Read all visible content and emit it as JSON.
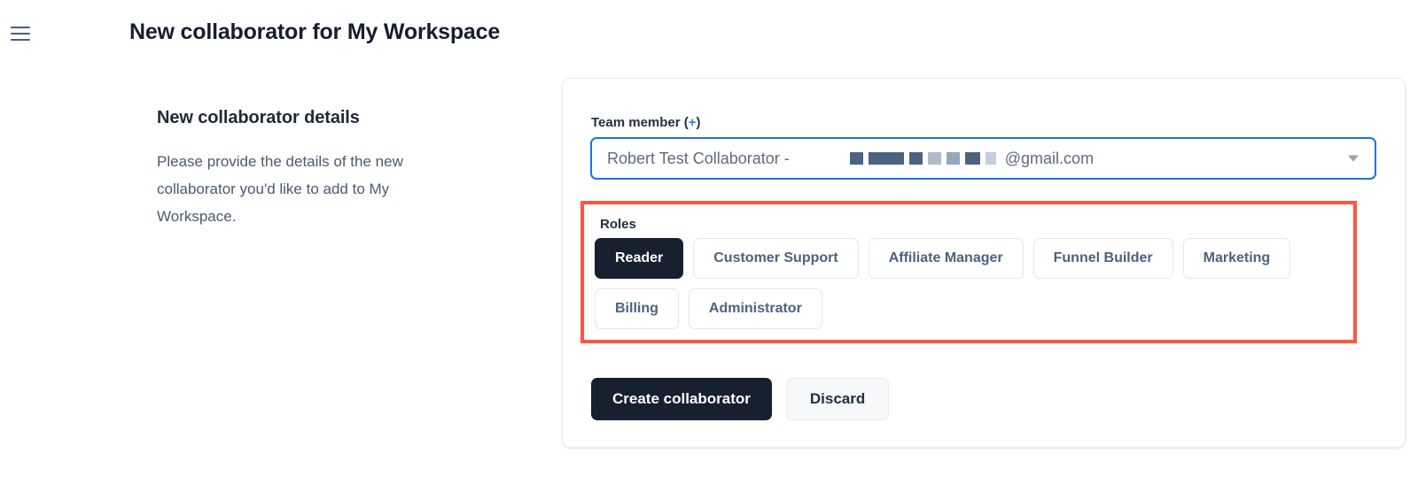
{
  "header": {
    "menu_icon": "hamburger-icon",
    "title": "New collaborator for My Workspace"
  },
  "left_panel": {
    "title": "New collaborator details",
    "body": "Please provide the details of the new collaborator you'd like to add to My Workspace."
  },
  "form": {
    "team_member": {
      "label": "Team member",
      "add_symbol": "(+)",
      "add_open_paren": "(",
      "add_plus": "+",
      "add_close_paren": ")",
      "selected_value": "Robert Test Collaborator -",
      "redacted_email_local": "[redacted]",
      "email_domain": "@gmail.com",
      "caret_icon": "chevron-down-icon",
      "focus_border_color": "#1a73e8",
      "redaction_blocks": [
        {
          "width": 15,
          "color": "#4d6versus"
        },
        {
          "width": 15,
          "color": "#4b6380"
        },
        {
          "width": 40,
          "color": "#4b6380"
        },
        {
          "width": 15,
          "color": "#4b6380"
        },
        {
          "width": 15,
          "color": "#aebbcb"
        },
        {
          "width": 15,
          "color": "#93a7bd"
        },
        {
          "width": 17,
          "color": "#4b6380"
        },
        {
          "width": 12,
          "color": "#c3cfdc"
        }
      ]
    },
    "roles": {
      "label": "Roles",
      "highlight_color": "#fc5643",
      "selected": "Reader",
      "rows": [
        [
          "Reader",
          "Customer Support",
          "Affiliate Manager",
          "Funnel Builder",
          "Marketing"
        ],
        [
          "Billing",
          "Administrator"
        ]
      ]
    },
    "actions": {
      "primary_label": "Create collaborator",
      "secondary_label": "Discard",
      "primary_color": "#16202f"
    }
  }
}
